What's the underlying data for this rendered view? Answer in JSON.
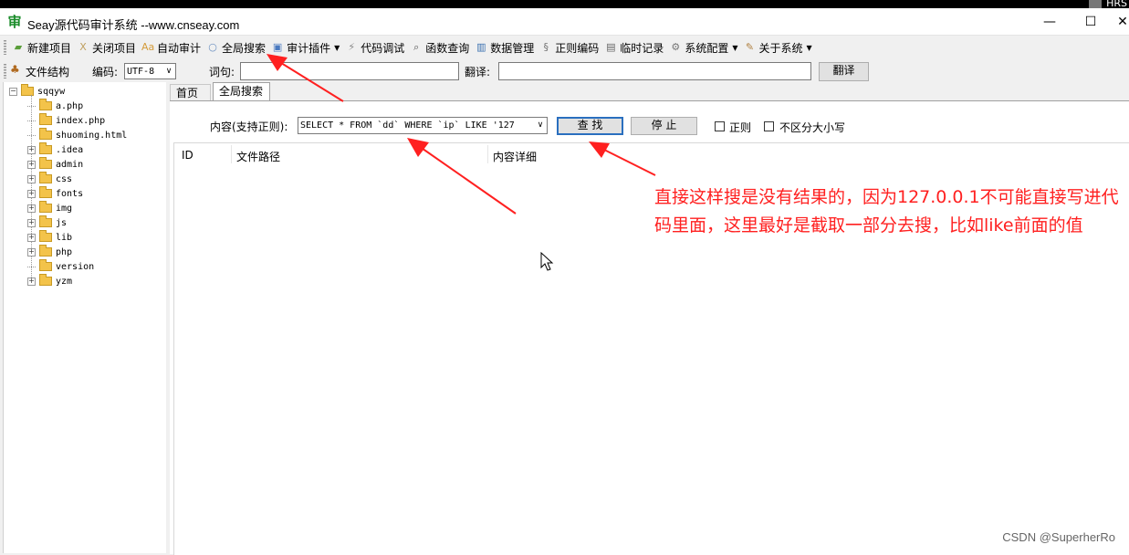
{
  "window": {
    "title": "Seay源代码审计系统  --www.cnseay.com",
    "user_badge": "HRS",
    "minimize": "—",
    "maximize": "☐",
    "close": "✕"
  },
  "toolbar": {
    "items": [
      {
        "label": "新建项目",
        "icon": "new-project-icon",
        "color": "#5a9e3a"
      },
      {
        "label": "关闭项目",
        "icon": "close-project-icon",
        "color": "#c0a060"
      },
      {
        "label": "自动审计",
        "icon": "auto-audit-icon",
        "color": "#d49b3a"
      },
      {
        "label": "全局搜索",
        "icon": "global-search-icon",
        "color": "#6a8fc0"
      },
      {
        "label": "审计插件",
        "icon": "plugin-icon",
        "color": "#4a7ac0",
        "dropdown": true
      },
      {
        "label": "代码调试",
        "icon": "debug-icon",
        "color": "#888888"
      },
      {
        "label": "函数查询",
        "icon": "function-search-icon",
        "color": "#555555"
      },
      {
        "label": "数据管理",
        "icon": "data-manage-icon",
        "color": "#3a70b0"
      },
      {
        "label": "正则编码",
        "icon": "regex-icon",
        "color": "#777777"
      },
      {
        "label": "临时记录",
        "icon": "notes-icon",
        "color": "#666666"
      },
      {
        "label": "系统配置",
        "icon": "gear-icon",
        "color": "#777777",
        "dropdown": true
      },
      {
        "label": "关于系统",
        "icon": "about-icon",
        "color": "#b08040",
        "dropdown": true
      }
    ]
  },
  "toolbar2": {
    "file_structure": "文件结构",
    "encoding_label": "编码:",
    "encoding_value": "UTF-8",
    "word_label": "词句:",
    "word_value": "",
    "translate_label": "翻译:",
    "translate_value": "",
    "translate_button": "翻译"
  },
  "tree": {
    "root": "sqqyw",
    "items": [
      {
        "label": "a.php",
        "expandable": false
      },
      {
        "label": "index.php",
        "expandable": false
      },
      {
        "label": "shuoming.html",
        "expandable": false
      },
      {
        "label": ".idea",
        "expandable": true
      },
      {
        "label": "admin",
        "expandable": true
      },
      {
        "label": "css",
        "expandable": true
      },
      {
        "label": "fonts",
        "expandable": true
      },
      {
        "label": "img",
        "expandable": true
      },
      {
        "label": "js",
        "expandable": true
      },
      {
        "label": "lib",
        "expandable": true
      },
      {
        "label": "php",
        "expandable": true
      },
      {
        "label": "version",
        "expandable": false
      },
      {
        "label": "yzm",
        "expandable": true
      }
    ]
  },
  "tabs": [
    {
      "label": "首页",
      "active": false
    },
    {
      "label": "全局搜索",
      "active": true
    }
  ],
  "search": {
    "label": "内容(支持正则):",
    "value": "SELECT * FROM  `dd` WHERE  `ip` LIKE  '127",
    "find_button": "查 找",
    "stop_button": "停 止",
    "regex_label": "正则",
    "case_label": "不区分大小写"
  },
  "results": {
    "columns": [
      "ID",
      "文件路径",
      "内容详细"
    ],
    "rows": []
  },
  "annotation": {
    "text": "直接这样搜是没有结果的，因为127.0.0.1不可能直接写进代码里面，这里最好是截取一部分去搜，比如like前面的值",
    "color": "#ff2020"
  },
  "watermark": "CSDN @SuperherRo"
}
